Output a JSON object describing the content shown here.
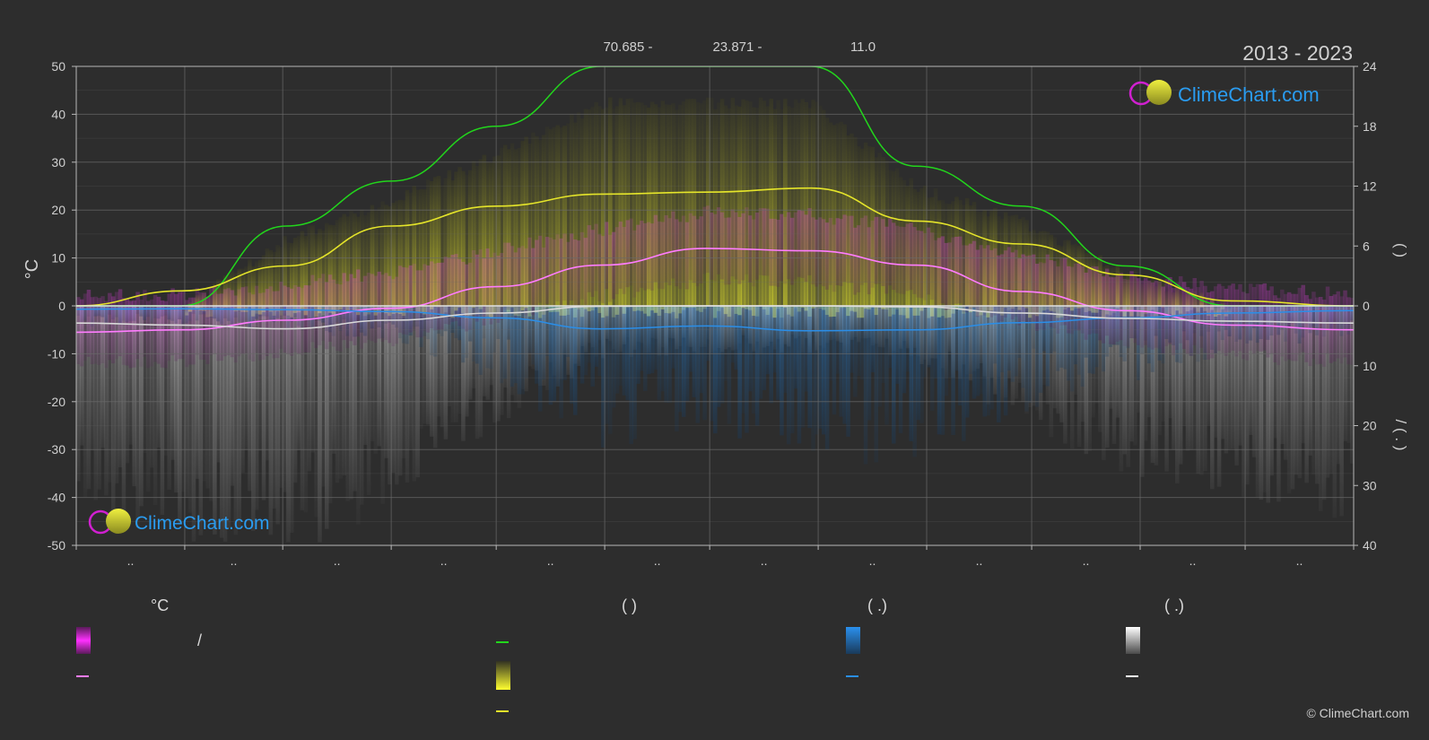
{
  "header": {
    "coords": [
      "70.685 -",
      "23.871 -",
      "11.0"
    ],
    "period": "2013 - 2023"
  },
  "brand": {
    "name": "ClimeChart.com",
    "copyright": "© ClimeChart.com"
  },
  "legend": {
    "col1": {
      "header": "°C",
      "item_sep": "/"
    },
    "col2": {
      "header": "(           )"
    },
    "col3": {
      "header": "(   .)"
    },
    "col4": {
      "header": "(   .)"
    }
  },
  "colors": {
    "background": "#2d2d2d",
    "grid": "#6a6a6a",
    "temp_range": "#d81fd8",
    "temp_mean": "#ff7cff",
    "daylight": "#22d61c",
    "sunshine": "#e5e52a",
    "rain": "#2a8ee8",
    "snow": "#d9d9d9",
    "brand_blue": "#2a9cf0"
  },
  "chart_data": {
    "type": "line",
    "title": "",
    "ylabel": "°C",
    "y2label_top": "(        )",
    "y2label_bottom": "/    (  .  )",
    "ylim": [
      -50,
      50
    ],
    "yticks": [
      50,
      40,
      30,
      20,
      10,
      0,
      -10,
      -20,
      -30,
      -40,
      -50
    ],
    "y2ticks_top": [
      24,
      18,
      12,
      6,
      0
    ],
    "y2ticks_bottom": [
      10,
      20,
      30,
      40
    ],
    "x_month_ticks": [
      "..",
      "..",
      "..",
      "..",
      "..",
      "..",
      "..",
      "..",
      "..",
      "..",
      "..",
      ".."
    ],
    "x": [
      0,
      30,
      60,
      90,
      120,
      150,
      180,
      210,
      240,
      270,
      300,
      330,
      365
    ],
    "series": [
      {
        "key": "daylight",
        "axis": "hours",
        "values": [
          0,
          0,
          8,
          12.5,
          18,
          24,
          24,
          24,
          14,
          10,
          4,
          0,
          0
        ]
      },
      {
        "key": "sunshine",
        "axis": "hours",
        "values": [
          0,
          1.5,
          4,
          8,
          10,
          11.2,
          11.4,
          11.8,
          8.5,
          6.2,
          3.1,
          0.5,
          0
        ]
      },
      {
        "key": "temp_mean",
        "axis": "celsius",
        "values": [
          -5.5,
          -5,
          -3,
          -0.5,
          4,
          8.5,
          12,
          11.5,
          8.5,
          3,
          -1,
          -4,
          -5
        ]
      },
      {
        "key": "rain",
        "axis": "mm",
        "values": [
          -0.7,
          -0.6,
          -0.8,
          -1.2,
          -2.5,
          -4.8,
          -4.2,
          -5.2,
          -5,
          -3.5,
          -2.5,
          -1.5,
          -1
        ]
      },
      {
        "key": "snow",
        "axis": "mm",
        "values": [
          -3.6,
          -4,
          -4.8,
          -3,
          -1.5,
          -0.1,
          0,
          0,
          -0.2,
          -1.5,
          -2.6,
          -3.2,
          -3.6
        ]
      }
    ]
  }
}
